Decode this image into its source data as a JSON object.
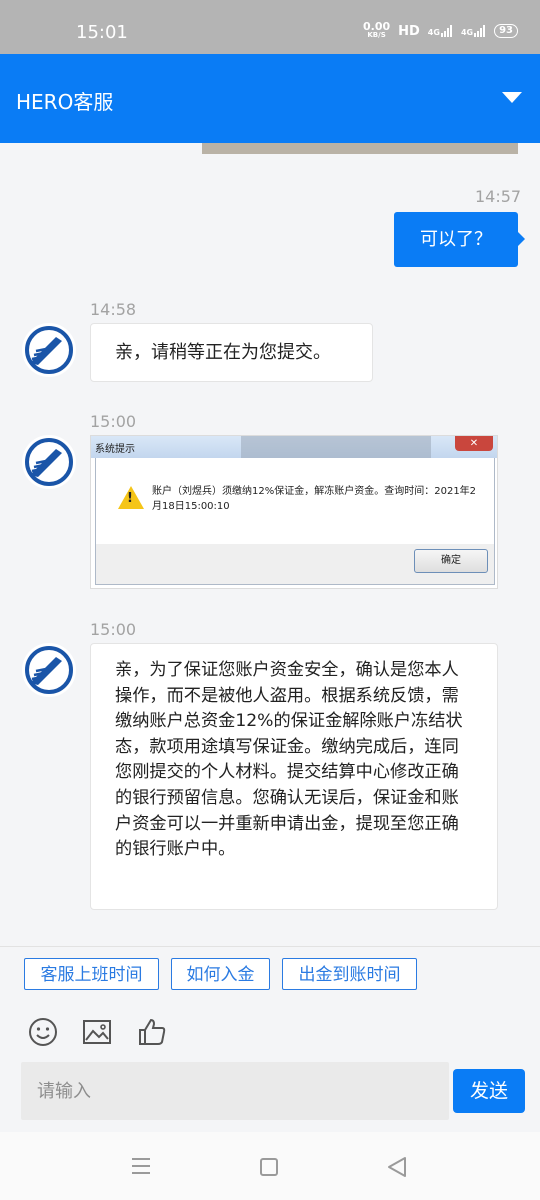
{
  "status_bar": {
    "time": "15:01",
    "net_speed_value": "0.00",
    "net_speed_unit": "KB/S",
    "hd": "HD",
    "signal1_label": "4G",
    "signal2_label": "4G",
    "battery": "93"
  },
  "header": {
    "title": "HERO客服",
    "dropdown_icon": "triangle-down-icon"
  },
  "messages": [
    {
      "time": "14:57",
      "sender": "user",
      "text": "可以了？"
    },
    {
      "time": "14:58",
      "sender": "agent",
      "text": "亲，请稍等正在为您提交。"
    },
    {
      "time": "15:00",
      "sender": "agent",
      "type": "image",
      "image": {
        "window_title": "系统提示",
        "message": "账户（刘煜兵）须缴纳12%保证金，解冻账户资金。查询时间：2021年2月18日15:00:10",
        "button": "确定"
      }
    },
    {
      "time": "15:00",
      "sender": "agent",
      "text": "亲，为了保证您账户资金安全，确认是您本人操作，而不是被他人盗用。根据系统反馈，需缴纳账户总资金12%的保证金解除账户冻结状态，款项用途填写保证金。缴纳完成后，连同您刚提交的个人材料。提交结算中心修改正确的银行预留信息。您确认无误后，保证金和账户资金可以一并重新申请出金，提现至您正确的银行账户中。"
    }
  ],
  "quick_replies": [
    "客服上班时间",
    "如何入金",
    "出金到账时间"
  ],
  "toolbar_icons": [
    "emoji-icon",
    "image-icon",
    "thumbs-up-icon"
  ],
  "input": {
    "placeholder": "请输入",
    "send_label": "发送"
  },
  "colors": {
    "primary": "#0a7cf5",
    "quick_reply_border": "#2b7be2",
    "background": "#f4f5f7"
  }
}
